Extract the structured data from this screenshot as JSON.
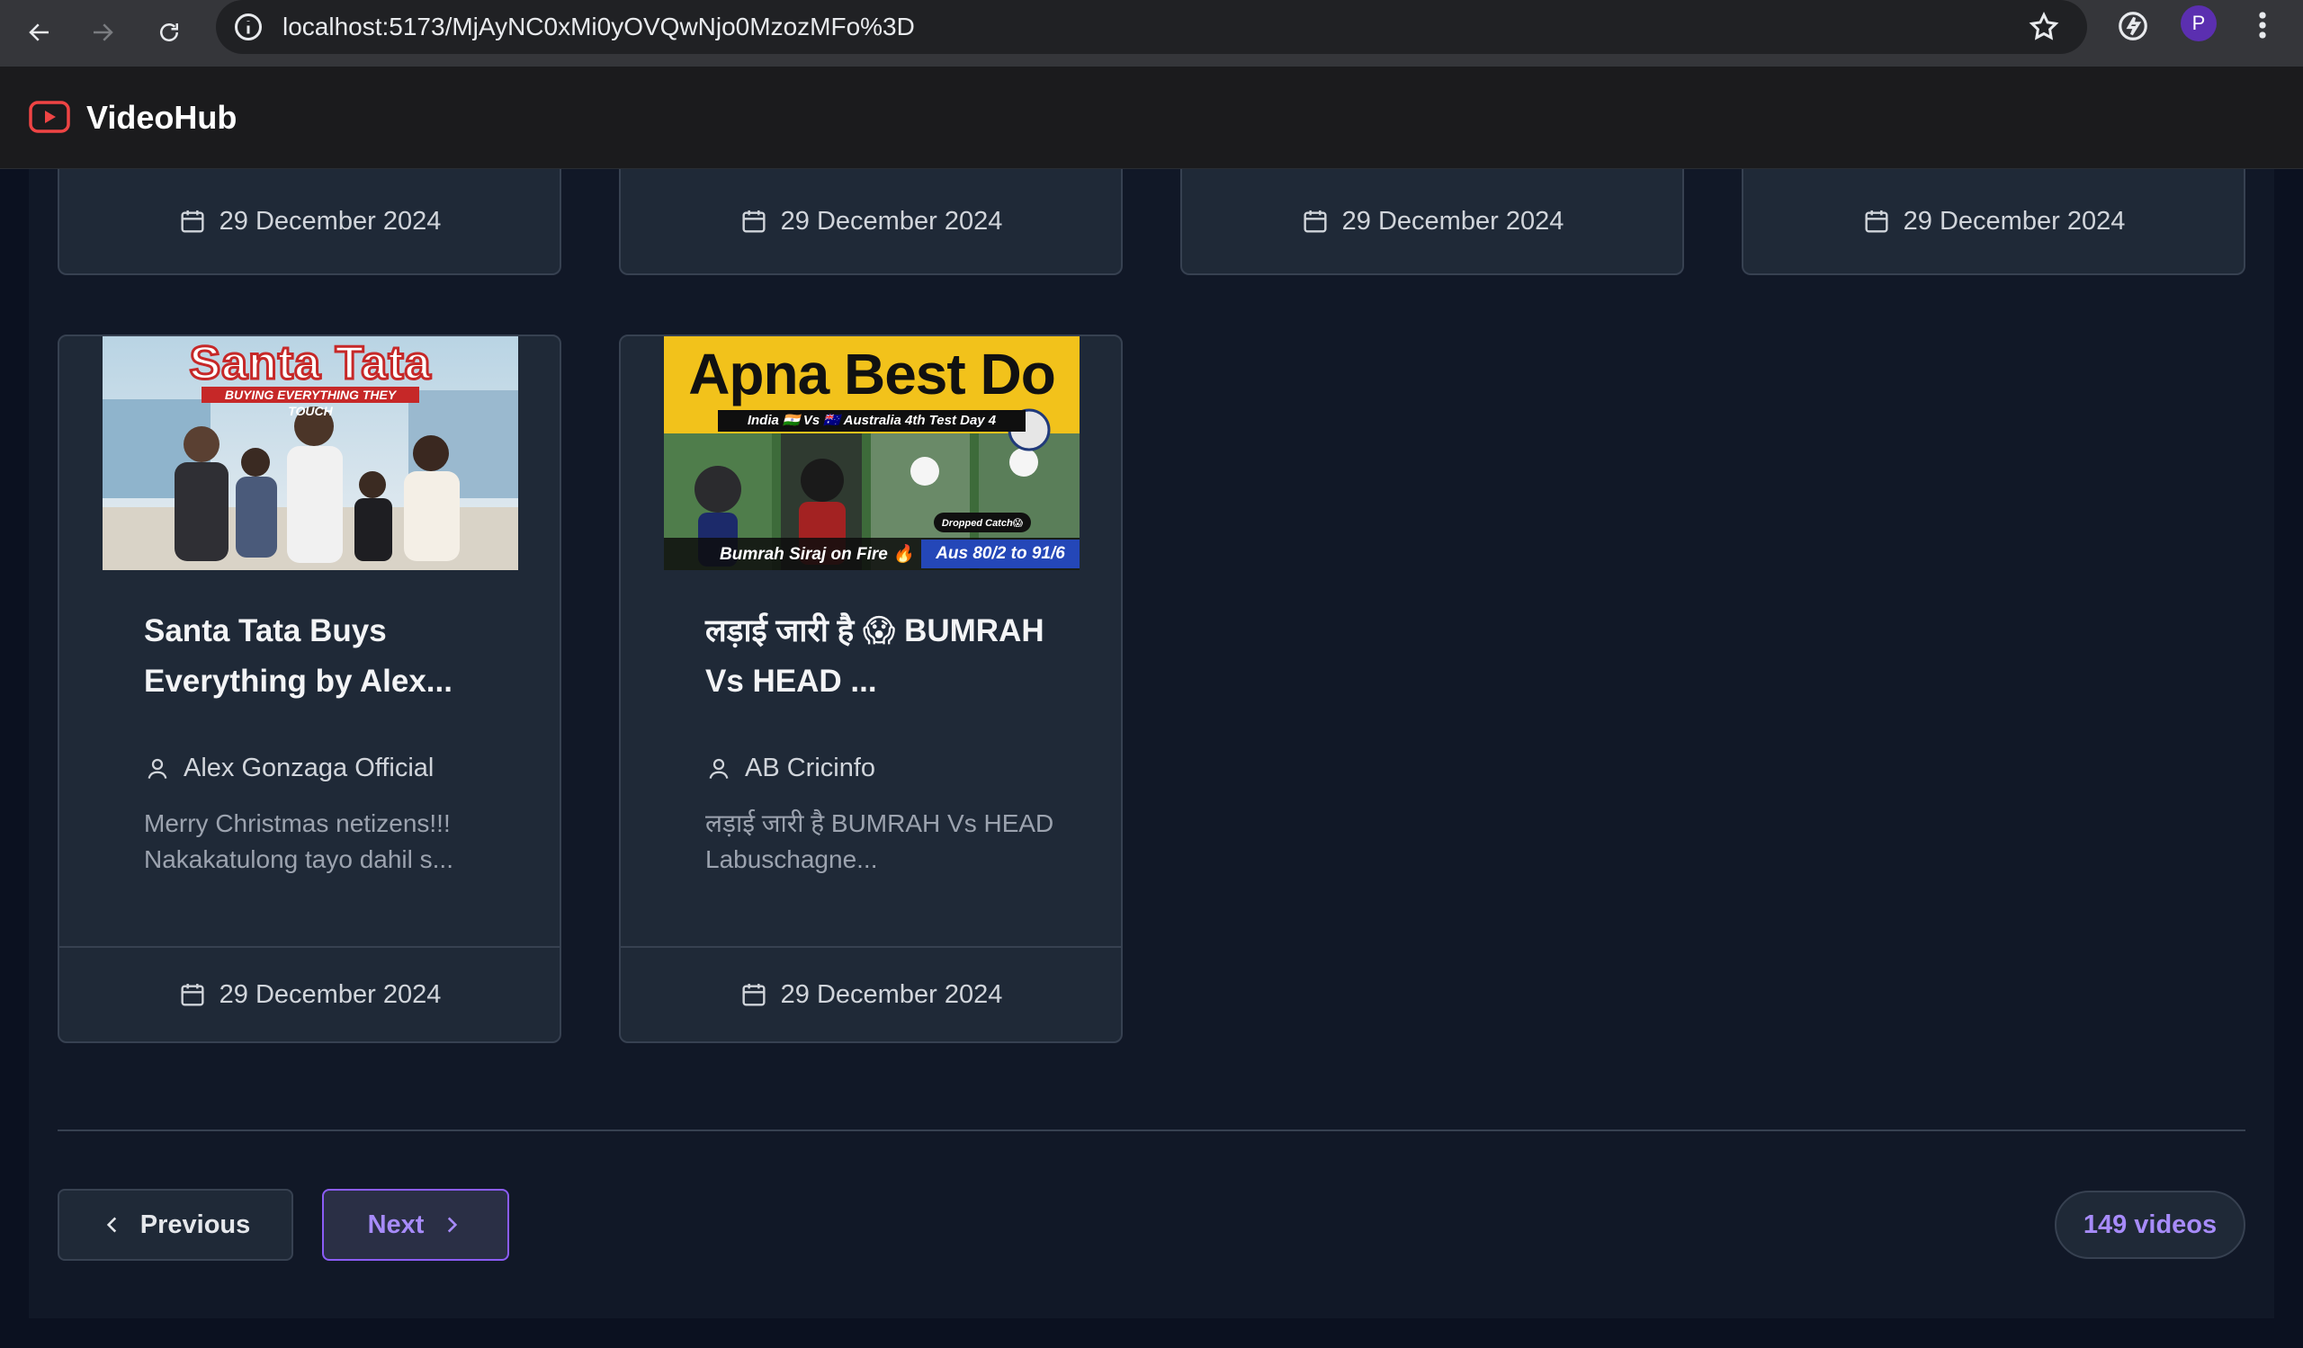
{
  "browser": {
    "url": "localhost:5173/MjAyNC0xMi0yOVQwNjo0MzozMFo%3D",
    "profile_initial": "P"
  },
  "app": {
    "title": "VideoHub",
    "accent_color": "#ef4444"
  },
  "top_row_dates": [
    "29 December 2024",
    "29 December 2024",
    "29 December 2024",
    "29 December 2024"
  ],
  "videos": [
    {
      "thumbnail": {
        "headline": "Santa Tata",
        "subline": "BUYING EVERYTHING THEY TOUCH"
      },
      "title": "Santa Tata Buys Everything by Alex...",
      "channel": "Alex Gonzaga Official",
      "description": "Merry Christmas netizens!!! Nakakatulong tayo dahil s...",
      "date": "29 December 2024"
    },
    {
      "thumbnail": {
        "headline": "Apna Best Do",
        "subline": "India 🇮🇳 Vs 🇦🇺 Australia 4th Test Day 4",
        "caption_left": "Bumrah Siraj on Fire 🔥",
        "caption_right": "Aus 80/2 to 91/6",
        "badge": "Dropped Catch😱"
      },
      "title": "लड़ाई जारी है 😱 BUMRAH Vs HEAD ...",
      "channel": "AB Cricinfo",
      "description": "लड़ाई जारी है BUMRAH Vs HEAD Labuschagne...",
      "date": "29 December 2024"
    }
  ],
  "pagination": {
    "previous_label": "Previous",
    "next_label": "Next",
    "count_label": "149 videos"
  }
}
